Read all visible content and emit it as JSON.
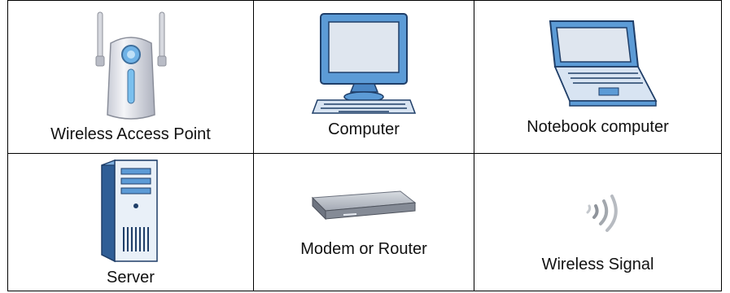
{
  "legend": {
    "cells": [
      {
        "label": "Wireless Access Point",
        "icon": "wireless-access-point-icon"
      },
      {
        "label": "Computer",
        "icon": "computer-icon"
      },
      {
        "label": "Notebook computer",
        "icon": "notebook-computer-icon"
      },
      {
        "label": "Server",
        "icon": "server-icon"
      },
      {
        "label": "Modem or Router",
        "icon": "modem-router-icon"
      },
      {
        "label": "Wireless Signal",
        "icon": "wireless-signal-icon"
      }
    ]
  }
}
